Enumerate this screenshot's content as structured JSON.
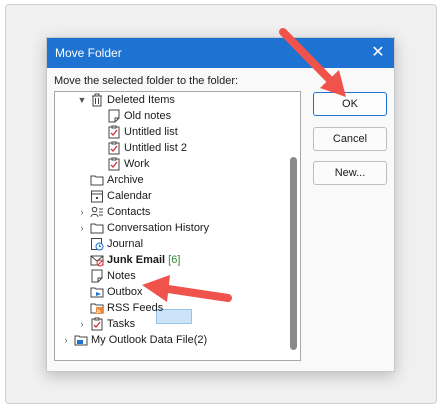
{
  "dialog": {
    "title": "Move Folder",
    "prompt": "Move the selected folder to the folder:"
  },
  "buttons": {
    "ok": "OK",
    "cancel": "Cancel",
    "new": "New..."
  },
  "tree": {
    "deleted_items": "Deleted Items",
    "old_notes": "Old notes",
    "untitled_list": "Untitled list",
    "untitled_list_2": "Untitled list 2",
    "work": "Work",
    "archive": "Archive",
    "calendar": "Calendar",
    "contacts": "Contacts",
    "conversation_history": "Conversation History",
    "journal": "Journal",
    "junk_email": "Junk Email",
    "junk_email_count": "[6]",
    "notes": "Notes",
    "outbox": "Outbox",
    "rss_feeds": "RSS Feeds",
    "tasks": "Tasks",
    "data_file": "My Outlook Data File(2)"
  },
  "colors": {
    "accent": "#1e73d2",
    "selection": "#cde3f7",
    "annotation_arrow": "#f0534b"
  }
}
